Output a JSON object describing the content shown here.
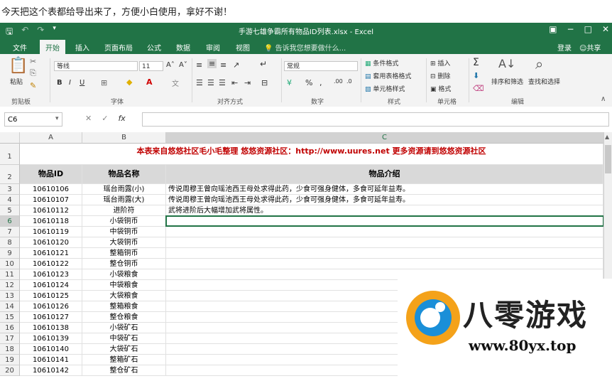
{
  "caption": "今天把这个表都给导出来了，方便小白使用，拿好不谢！",
  "window": {
    "title": "手游七雄争霸所有物品ID列表.xlsx - Excel"
  },
  "tabs": [
    "文件",
    "开始",
    "插入",
    "页面布局",
    "公式",
    "数据",
    "审阅",
    "视图"
  ],
  "tell_me": "告诉我您想要做什么...",
  "login": "登录",
  "share": "共享",
  "ribbon": {
    "clipboard": {
      "paste": "粘贴",
      "label": "剪贴板"
    },
    "font": {
      "name": "等线",
      "size": "11",
      "label": "字体"
    },
    "alignment": {
      "label": "对齐方式"
    },
    "number": {
      "format": "常规",
      "label": "数字"
    },
    "styles": {
      "conditional": "条件格式",
      "table": "套用表格格式",
      "cell": "单元格样式",
      "label": "样式"
    },
    "cells": {
      "insert": "插入",
      "delete": "删除",
      "format": "格式",
      "label": "单元格"
    },
    "editing": {
      "sort": "排序和筛选",
      "find": "查找和选择",
      "label": "编辑"
    }
  },
  "namebox": "C6",
  "columns": [
    "A",
    "B",
    "C"
  ],
  "rows": [
    {
      "n": "1",
      "a": "",
      "b": "",
      "c": "本表来自悠悠社区毛小毛整理  悠悠资源社区：http://www.uures.net   更多资源请到悠悠资源社区"
    },
    {
      "n": "2",
      "a": "物品ID",
      "b": "物品名称",
      "c": "物品介绍"
    },
    {
      "n": "3",
      "a": "10610106",
      "b": "瑶台雨露(小)",
      "c": "传说周穆王曾向瑶池西王母处求得此药，少食可强身健体，多食可延年益寿。"
    },
    {
      "n": "4",
      "a": "10610107",
      "b": "瑶台雨露(大)",
      "c": "传说周穆王曾向瑶池西王母处求得此药，少食可强身健体，多食可延年益寿。"
    },
    {
      "n": "5",
      "a": "10610112",
      "b": "进阶符",
      "c": "武将进阶后大幅增加武将属性。"
    },
    {
      "n": "6",
      "a": "10610118",
      "b": "小袋铜币",
      "c": ""
    },
    {
      "n": "7",
      "a": "10610119",
      "b": "中袋铜币",
      "c": ""
    },
    {
      "n": "8",
      "a": "10610120",
      "b": "大袋铜币",
      "c": ""
    },
    {
      "n": "9",
      "a": "10610121",
      "b": "整箱铜币",
      "c": ""
    },
    {
      "n": "10",
      "a": "10610122",
      "b": "整仓铜币",
      "c": ""
    },
    {
      "n": "11",
      "a": "10610123",
      "b": "小袋粮食",
      "c": ""
    },
    {
      "n": "12",
      "a": "10610124",
      "b": "中袋粮食",
      "c": ""
    },
    {
      "n": "13",
      "a": "10610125",
      "b": "大袋粮食",
      "c": ""
    },
    {
      "n": "14",
      "a": "10610126",
      "b": "整箱粮食",
      "c": ""
    },
    {
      "n": "15",
      "a": "10610127",
      "b": "整仓粮食",
      "c": ""
    },
    {
      "n": "16",
      "a": "10610138",
      "b": "小袋矿石",
      "c": ""
    },
    {
      "n": "17",
      "a": "10610139",
      "b": "中袋矿石",
      "c": ""
    },
    {
      "n": "18",
      "a": "10610140",
      "b": "大袋矿石",
      "c": ""
    },
    {
      "n": "19",
      "a": "10610141",
      "b": "整箱矿石",
      "c": ""
    },
    {
      "n": "20",
      "a": "10610142",
      "b": "整仓矿石",
      "c": ""
    }
  ],
  "watermark": {
    "name": "八零游戏",
    "url": "www.80yx.top"
  }
}
